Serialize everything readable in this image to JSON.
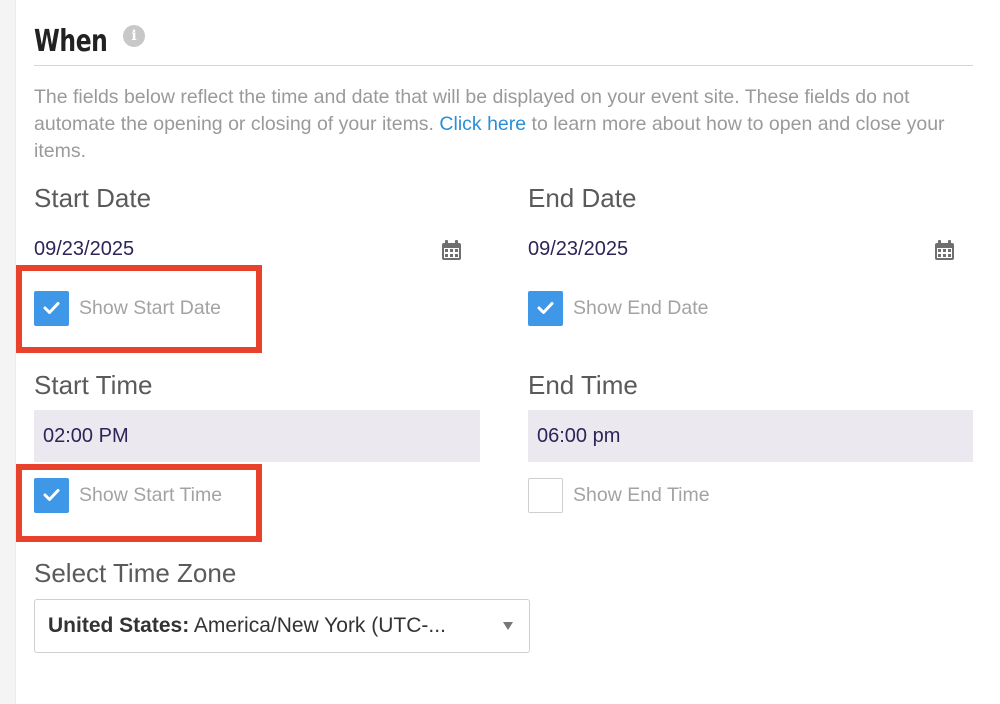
{
  "section": {
    "title": "When",
    "info_icon": "info-icon"
  },
  "help": {
    "text_before": "The fields below reflect the time and date that will be displayed on your event site. These fields do not automate the opening or closing of your items. ",
    "link_text": "Click here",
    "text_after": " to learn more about how to open and close your items."
  },
  "start_date": {
    "label": "Start Date",
    "value": "09/23/2025",
    "icon": "calendar-icon",
    "show_label": "Show Start Date",
    "show_checked": true
  },
  "end_date": {
    "label": "End Date",
    "value": "09/23/2025",
    "icon": "calendar-icon",
    "show_label": "Show End Date",
    "show_checked": true
  },
  "start_time": {
    "label": "Start Time",
    "value": "02:00 PM",
    "show_label": "Show Start Time",
    "show_checked": true
  },
  "end_time": {
    "label": "End Time",
    "value": "06:00 pm",
    "show_label": "Show End Time",
    "show_checked": false
  },
  "timezone": {
    "label": "Select Time Zone",
    "selected_country": "United States:",
    "selected_zone": " America/New York (UTC-..."
  },
  "colors": {
    "accent": "#3f97e8",
    "highlight": "#e8412c",
    "link": "#2a8fd6",
    "input_bg": "#ebe8f0"
  }
}
